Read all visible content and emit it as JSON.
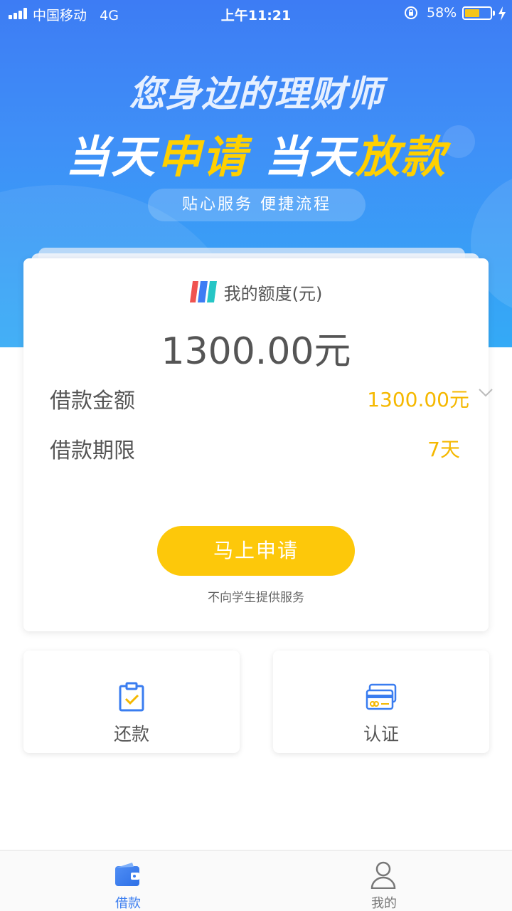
{
  "status_bar": {
    "carrier": "中国移动",
    "network": "4G",
    "time": "上午11:21",
    "battery_percent": "58%",
    "battery_level": 0.58
  },
  "banner": {
    "headline1": "您身边的理财师",
    "headline2_a": "当天",
    "headline2_b": "申请",
    "headline2_c": "当天",
    "headline2_d": "放款",
    "tagline": "贴心服务 便捷流程"
  },
  "quota_card": {
    "label": "我的额度(元)",
    "amount": "1300.00元",
    "loan_amount_label": "借款金额",
    "loan_amount_value": "1300.00元",
    "loan_term_label": "借款期限",
    "loan_term_value": "7天",
    "apply_button": "马上申请",
    "note": "不向学生提供服务"
  },
  "tiles": [
    {
      "label": "还款",
      "icon": "clipboard-check-icon"
    },
    {
      "label": "认证",
      "icon": "credit-card-icon"
    }
  ],
  "tabbar": [
    {
      "label": "借款",
      "icon": "wallet-icon",
      "active": true
    },
    {
      "label": "我的",
      "icon": "user-icon",
      "active": false
    }
  ],
  "colors": {
    "primary_blue": "#3a7df0",
    "accent_yellow": "#fdc80a",
    "value_yellow": "#f5b800"
  }
}
